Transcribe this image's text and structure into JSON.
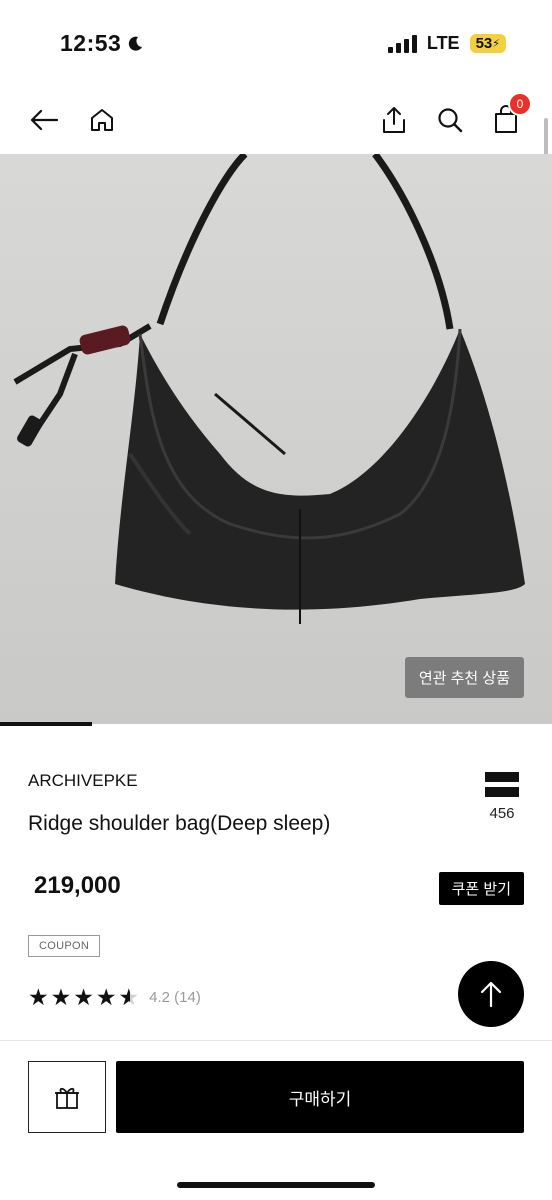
{
  "status_bar": {
    "time": "12:53",
    "network": "LTE",
    "battery": "53"
  },
  "nav": {
    "cart_count": "0",
    "icons": [
      "back-arrow-icon",
      "home-icon",
      "share-icon",
      "search-icon",
      "cart-icon"
    ]
  },
  "hero": {
    "related_label": "연관 추천 상품",
    "image_subject": "black leather shoulder bag with red toggle on grey background"
  },
  "product": {
    "brand": "ARCHIVEPKE",
    "title": "Ridge shoulder bag(Deep sleep)",
    "like_count": "456",
    "price": "219,000",
    "coupon_button": "쿠폰 받기",
    "coupon_tag": "COUPON",
    "rating": 4.2,
    "rating_text": "4.2 (14)"
  },
  "bottom_bar": {
    "buy_label": "구매하기"
  },
  "colors": {
    "accent": "#000000",
    "badge": "#e8312a",
    "battery": "#f4d03f"
  }
}
